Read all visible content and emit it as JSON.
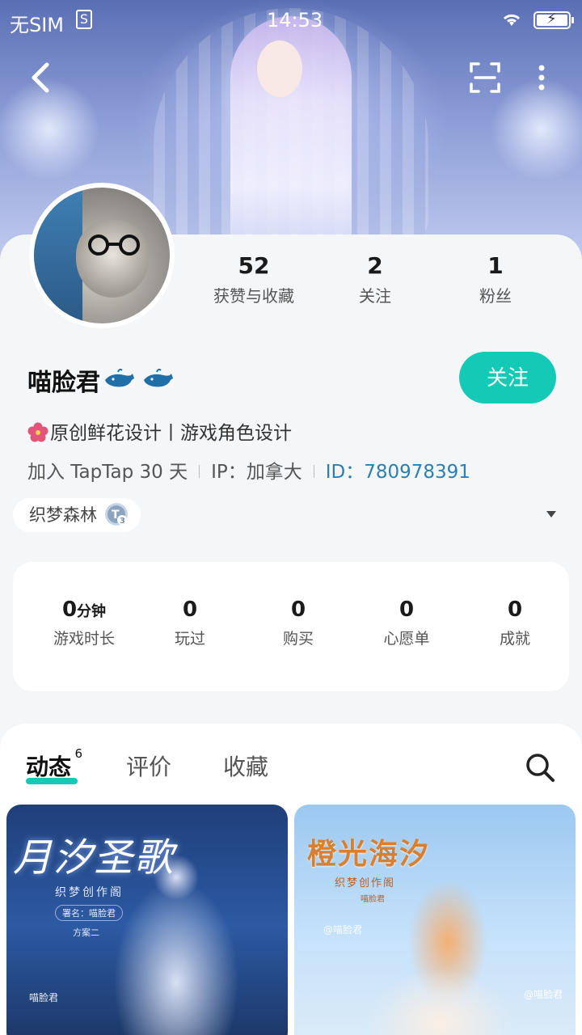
{
  "status_bar": {
    "carrier": "无SIM",
    "sim_icon": "S",
    "time": "14:53"
  },
  "stats": [
    {
      "value": "52",
      "label": "获赞与收藏"
    },
    {
      "value": "2",
      "label": "关注"
    },
    {
      "value": "1",
      "label": "粉丝"
    }
  ],
  "profile": {
    "name": "喵脸君",
    "follow_label": "关注",
    "bio": "原创鲜花设计丨游戏角色设计",
    "joined": "加入 TapTap 30 天",
    "ip": "IP：加拿大",
    "user_id": "ID：780978391",
    "guild": "织梦森林"
  },
  "game_stats": [
    {
      "value": "0",
      "unit": "分钟",
      "label": "游戏时长"
    },
    {
      "value": "0",
      "unit": "",
      "label": "玩过"
    },
    {
      "value": "0",
      "unit": "",
      "label": "购买"
    },
    {
      "value": "0",
      "unit": "",
      "label": "心愿单"
    },
    {
      "value": "0",
      "unit": "",
      "label": "成就"
    }
  ],
  "tabs": [
    {
      "label": "动态",
      "count": "6"
    },
    {
      "label": "评价"
    },
    {
      "label": "收藏"
    }
  ],
  "posts": [
    {
      "title": "月汐圣歌",
      "subtitle": "织梦创作阁",
      "credit": "署名：喵脸君",
      "note": "方案二",
      "watermark": "喵脸君"
    },
    {
      "title": "橙光海汐",
      "subtitle": "织梦创作阁",
      "credit": "喵脸君",
      "watermark": "@喵脸君",
      "watermark2": "@喵脸君"
    }
  ],
  "colors": {
    "accent": "#15c9b7",
    "id_link": "#2b7fb2"
  }
}
